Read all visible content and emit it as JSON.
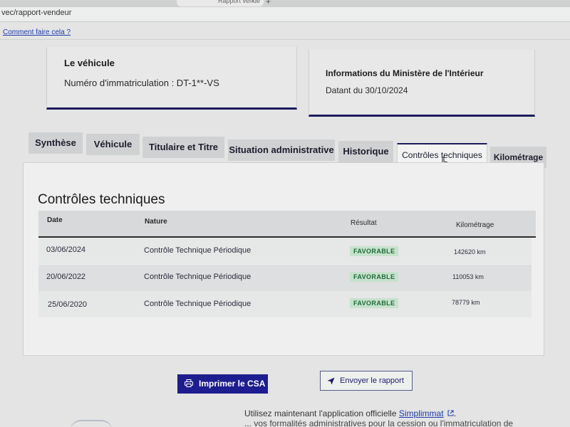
{
  "browser": {
    "tab_label": "Rapport vende",
    "tab_close": "×",
    "new_tab": "+",
    "url": "vec/rapport-vendeur"
  },
  "help_link": "Comment faire cela ?",
  "vehicle_card": {
    "title": "Le véhicule",
    "registration": "Numéro d'immatriculation : DT-1**-VS"
  },
  "ministry_card": {
    "title": "Informations du Ministère de l'Intérieur",
    "date": "Datant du 30/10/2024"
  },
  "tabs": [
    {
      "label": "Synthèse"
    },
    {
      "label": "Véhicule"
    },
    {
      "label": "Titulaire et Titre"
    },
    {
      "label": "Situation administrative"
    },
    {
      "label": "Historique"
    },
    {
      "label": "Contrôles techniques"
    },
    {
      "label": "Kilométrage"
    }
  ],
  "active_tab": "Contrôles techniques",
  "section": {
    "title": "Contrôles techniques",
    "headers": {
      "date": "Date",
      "nature": "Nature",
      "result": "Résultat",
      "mileage": "Kilométrage"
    },
    "rows": [
      {
        "date": "03/06/2024",
        "nature": "Contrôle Technique Périodique",
        "result": "FAVORABLE",
        "mileage": "142620 km"
      },
      {
        "date": "20/06/2022",
        "nature": "Contrôle Technique Périodique",
        "result": "FAVORABLE",
        "mileage": "110053 km"
      },
      {
        "date": "25/06/2020",
        "nature": "Contrôle Technique Périodique",
        "result": "FAVORABLE",
        "mileage": "78779 km"
      }
    ]
  },
  "buttons": {
    "print": "Imprimer le CSA",
    "send": "Envoyer le rapport"
  },
  "footer": {
    "line1_prefix": "Utilisez maintenant l'application officielle ",
    "line1_link": "Simplimmat",
    "line1_suffix": ".",
    "line2": "... vos formalités administratives pour la cession ou l'immatriculation de"
  },
  "colors": {
    "primary": "#1d1d8f",
    "card_border": "#1c1c5e",
    "badge_bg": "#c6e2cd",
    "badge_text": "#1e6b38",
    "link": "#1f3bb0"
  },
  "icons": {
    "print": "printer-icon",
    "send": "paper-plane-icon",
    "external": "external-link-icon",
    "cursor": "hand-pointer-icon"
  }
}
